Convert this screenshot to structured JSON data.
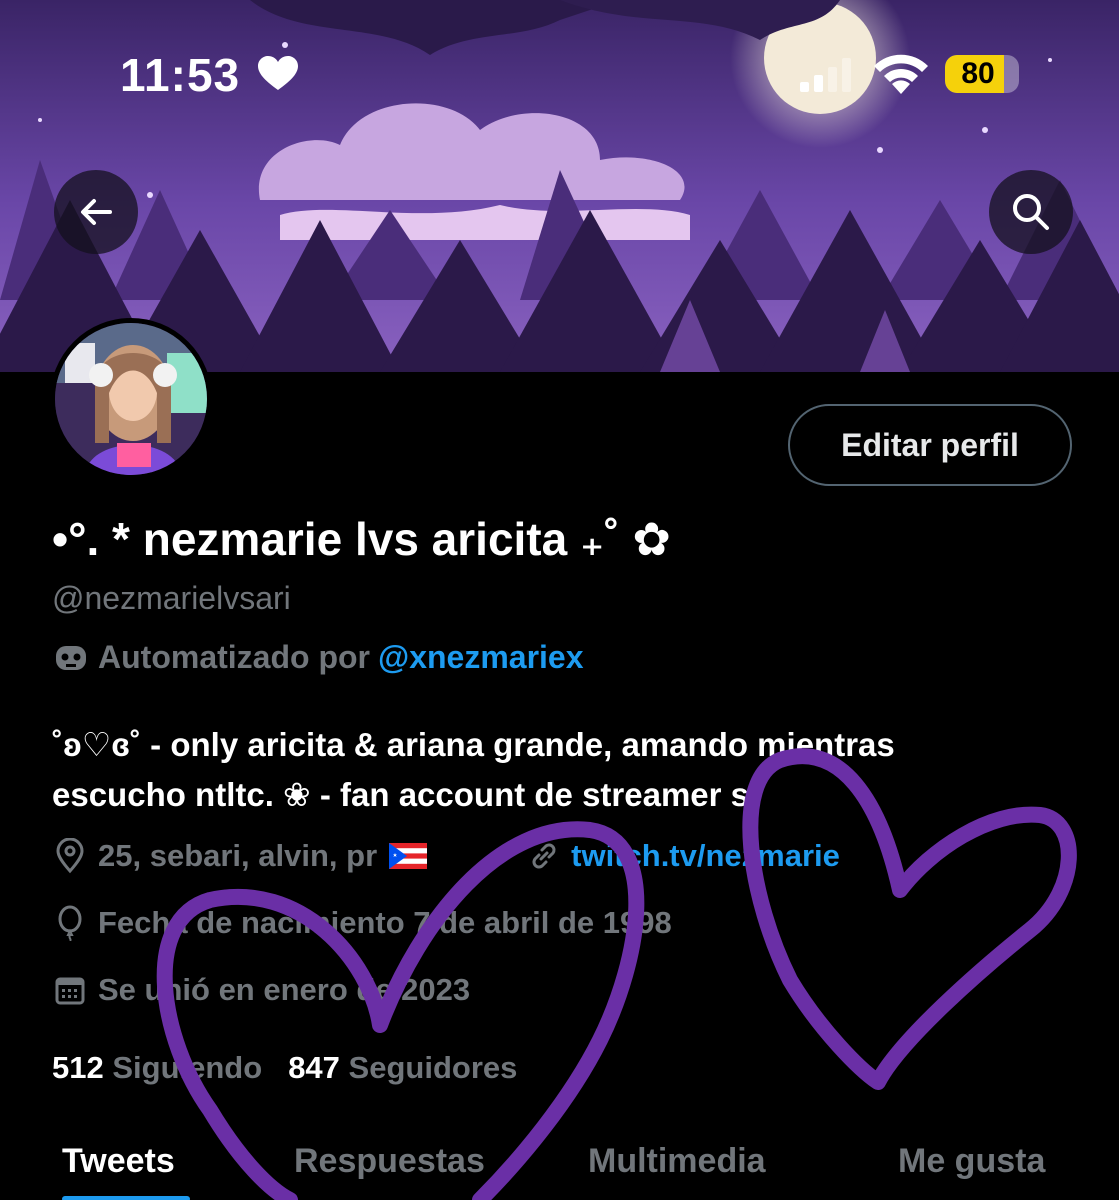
{
  "status": {
    "time": "11:53",
    "battery": "80",
    "battery_fraction": 0.8,
    "heart_icon": "heart-icon",
    "signal_icon": "cellular-signal-icon",
    "wifi_icon": "wifi-icon"
  },
  "header": {
    "back_icon": "arrow-left-icon",
    "search_icon": "search-icon"
  },
  "profile": {
    "display_name": "•°. * nezmarie lvs aricita ₊˚ ✿",
    "handle": "@nezmarielvsari",
    "automated_prefix": "Automatizado por",
    "automated_by": "@xnezmariex",
    "edit_button": "Editar perfil",
    "bio_line1": "˚ʚ♡ɞ˚ - only aricita & ariana grande, amando mientras",
    "bio_line2": "escucho ntltc. ❀ - fan account de streamer s",
    "location": "25, sebari, alvin, pr",
    "website": "twitch.tv/nezmarie",
    "birthday": "Fecha de nacimiento 7 de abril de 1998",
    "joined": "Se unió en enero de 2023",
    "following_count": "512",
    "following_label": "Siguiendo",
    "followers_count": "847",
    "followers_label": "Seguidores"
  },
  "tabs": [
    {
      "label": "Tweets",
      "active": true
    },
    {
      "label": "Respuestas",
      "active": false
    },
    {
      "label": "Multimedia",
      "active": false
    },
    {
      "label": "Me gusta",
      "active": false
    }
  ],
  "colors": {
    "accent": "#1d9bf0",
    "muted": "#71767b",
    "banner_sky": "#5b3c95",
    "marker_purple": "#6a2fa6",
    "battery": "#f5d10b"
  }
}
